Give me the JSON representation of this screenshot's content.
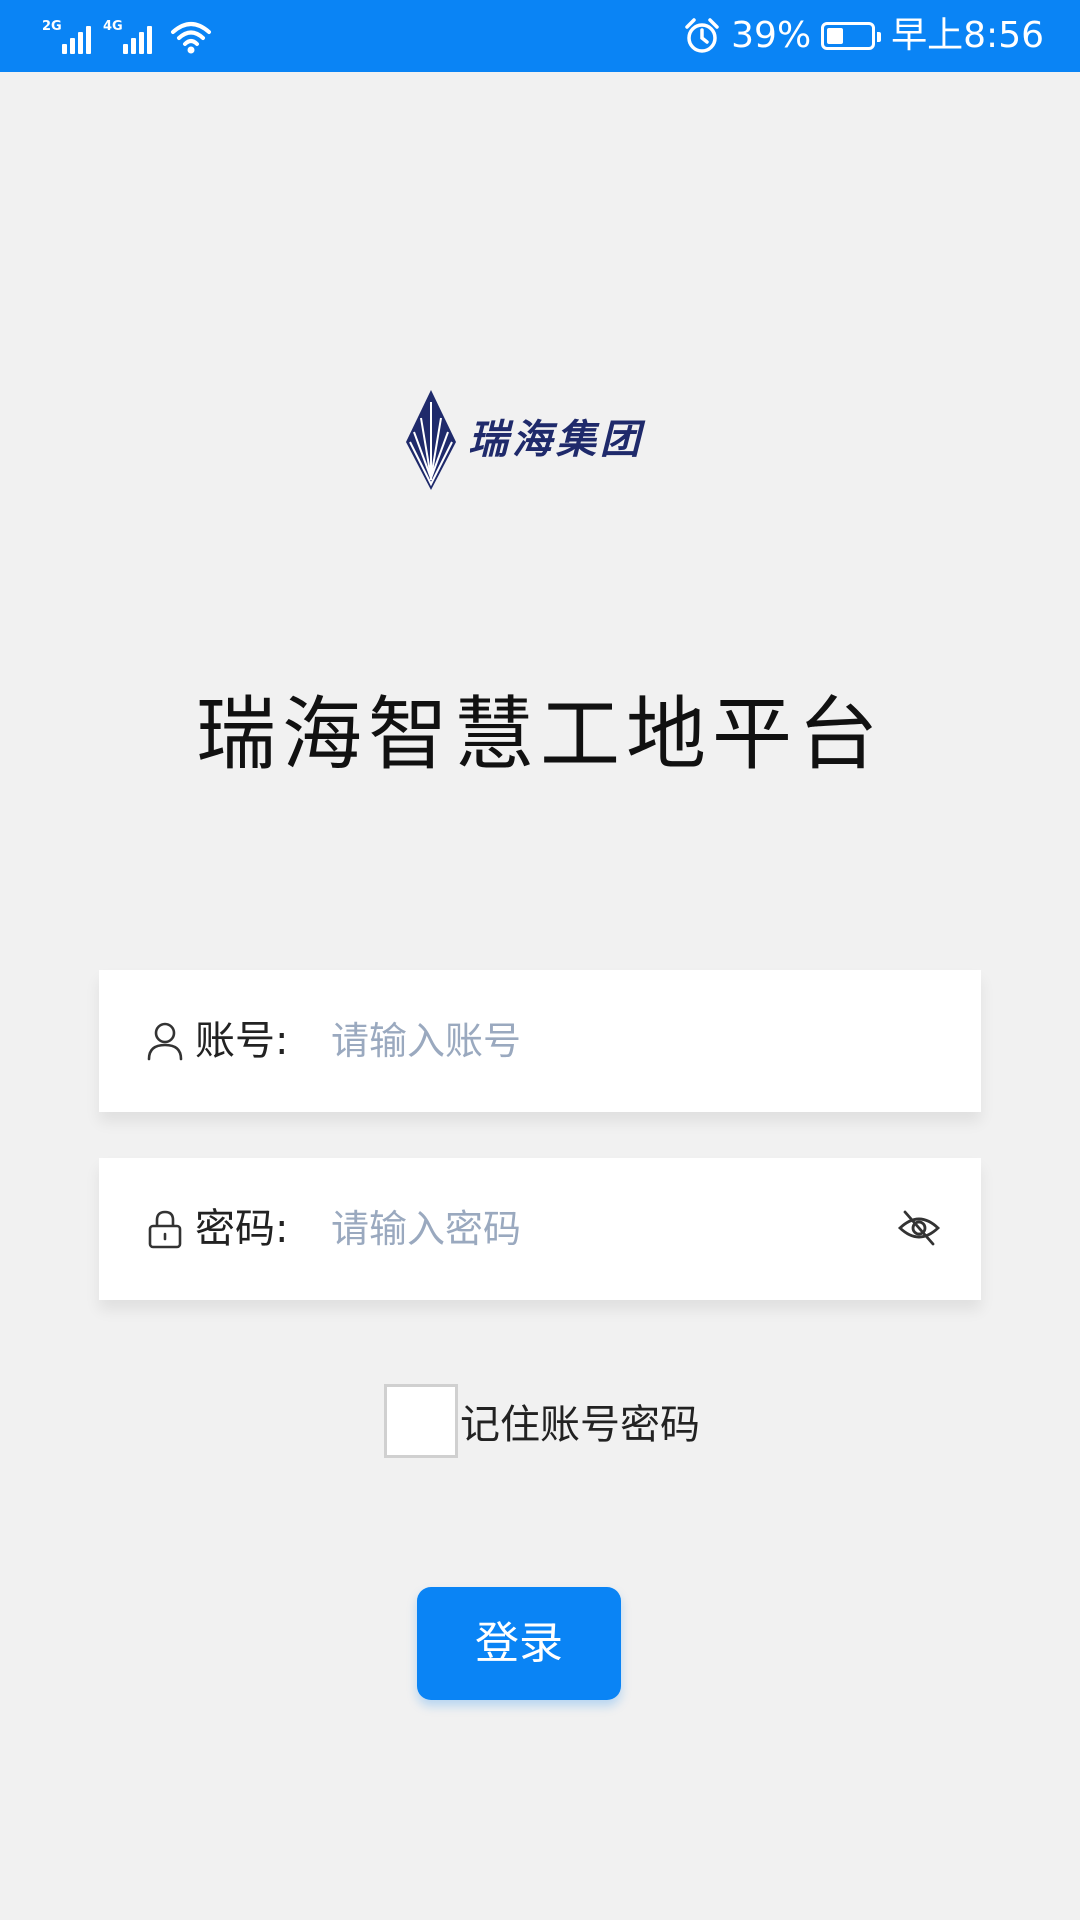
{
  "status_bar": {
    "network_1": "2G",
    "network_2": "4G",
    "battery_percent": "39%",
    "battery_level": 0.39,
    "time": "早上8:56",
    "icons": [
      "signal-icon",
      "wifi-icon",
      "alarm-icon",
      "battery-icon"
    ]
  },
  "logo": {
    "text": "瑞海集团"
  },
  "title": "瑞海智慧工地平台",
  "account": {
    "label": "账号:",
    "placeholder": "请输入账号",
    "value": ""
  },
  "password": {
    "label": "密码:",
    "placeholder": "请输入密码",
    "value": ""
  },
  "remember": {
    "label": "记住账号密码",
    "checked": false
  },
  "login": {
    "label": "登录"
  },
  "colors": {
    "accent": "#0a84f5",
    "background": "#f1f1f1",
    "logo": "#1f2a6b",
    "placeholder": "#9aa9bf"
  }
}
